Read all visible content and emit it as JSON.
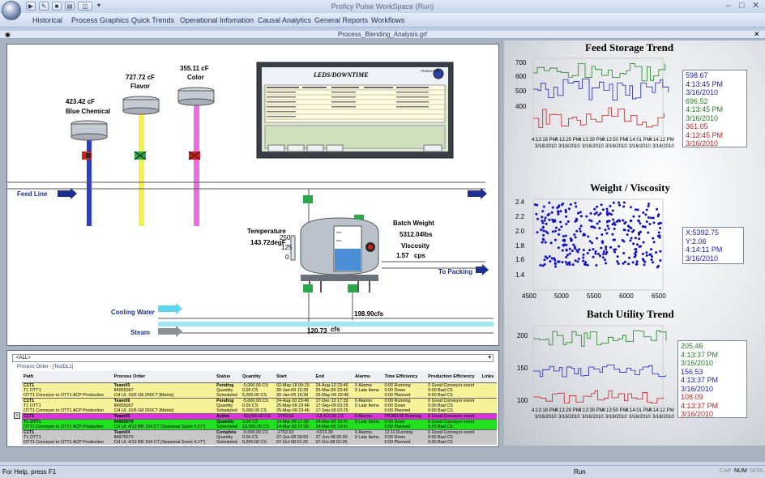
{
  "window": {
    "title": "Proficy Pulse WorkSpace (Run)",
    "document_title": "Process_Blending_Analysis.grf"
  },
  "menu": [
    "Historical",
    "Process Graphics",
    "Quick Trends",
    "Operational Infomation",
    "Causal Analytics",
    "General Reports",
    "Workflows"
  ],
  "process": {
    "blue_chemical": {
      "value": "423.42 cF",
      "name": "Blue Chemical"
    },
    "flavor": {
      "value": "727.72 cF",
      "name": "Flavor"
    },
    "color": {
      "value": "355.11 cF",
      "name": "Color"
    },
    "feed_line": "Feed Line",
    "temperature_label": "Temperature",
    "temperature_value": "143.72degF",
    "level_ticks": [
      "250",
      "125",
      "0"
    ],
    "batch_weight_label": "Batch Weight",
    "batch_weight_value": "5312.04lbs",
    "viscosity_label": "Viscosity",
    "viscosity_value": "1.57",
    "viscosity_unit": "cps",
    "to_packing": "To Packing",
    "cooling_water": "Cooling Water",
    "steam": "Steam",
    "flow1": "198.90cfs",
    "flow2": "120.73",
    "flow2_unit": "cfs",
    "leds_title": "LEDS/DOWNTIME",
    "leds_logo": "PENNSTATE"
  },
  "feed_storage": {
    "title": "Feed Storage Trend",
    "yticks": [
      "700",
      "600",
      "500",
      "400"
    ],
    "xticks": [
      {
        "t": "4:13:18 PM",
        "d": "3/16/2010"
      },
      {
        "t": "4:13:29 PM",
        "d": "3/16/2010"
      },
      {
        "t": "4:13:39 PM",
        "d": "3/16/2010"
      },
      {
        "t": "4:13:50 PM",
        "d": "3/16/2010"
      },
      {
        "t": "4:14:01 PM",
        "d": "3/16/2010"
      },
      {
        "t": "4:14:12 PM",
        "d": "3/16/2010"
      }
    ],
    "readout": [
      {
        "v": "598.67",
        "t": "4:13:45 PM",
        "d": "3/16/2010",
        "color": "#2020c0"
      },
      {
        "v": "696.52",
        "t": "4:13:45 PM",
        "d": "3/16/2010",
        "color": "#208020"
      },
      {
        "v": "361.05",
        "t": "4:13:45 PM",
        "d": "3/16/2010",
        "color": "#c02020"
      }
    ]
  },
  "weight_viscosity": {
    "title": "Weight / Viscosity",
    "yticks": [
      "2.4",
      "2.2",
      "2.0",
      "1.8",
      "1.6",
      "1.4"
    ],
    "xticks": [
      "4500",
      "5000",
      "5500",
      "6000",
      "6500"
    ],
    "readout": [
      "X:5392.75",
      "Y:2.06",
      "4:14:11 PM",
      "3/16/2010"
    ]
  },
  "batch_utility": {
    "title": "Batch Utility Trend",
    "yticks": [
      "200",
      "150",
      "100"
    ],
    "xticks": [
      {
        "t": "4:13:18 PM",
        "d": "3/16/2010"
      },
      {
        "t": "4:13:29 PM",
        "d": "3/16/2010"
      },
      {
        "t": "4:13:39 PM",
        "d": "3/16/2010"
      },
      {
        "t": "4:13:50 PM",
        "d": "3/16/2010"
      },
      {
        "t": "4:14:01 PM",
        "d": "3/16/2010"
      },
      {
        "t": "4:14:12 PM",
        "d": "3/16/2010"
      }
    ],
    "readout": [
      {
        "v": "205.46",
        "t": "4:13:37 PM",
        "d": "3/16/2010",
        "color": "#208020"
      },
      {
        "v": "156.53",
        "t": "4:13:37 PM",
        "d": "3/16/2010",
        "color": "#2020c0"
      },
      {
        "v": "108.09",
        "t": "4:13:37 PM",
        "d": "3/16/2010",
        "color": "#c02020"
      }
    ]
  },
  "orders": {
    "dropdown": "<ALL>",
    "caption": "Process Order - [TestDL1]",
    "headers": [
      "Path",
      "Process Order",
      "Status",
      "Quantity",
      "Start",
      "End",
      "Alarms",
      "Time Efficiency",
      "Production Efficiency",
      "Links"
    ],
    "rows": [
      {
        "bg": "#f6f29a",
        "lines": [
          [
            "C1T1",
            "Team05",
            "Pending",
            "-5,000.00 CS",
            "02-May-18 00:15",
            "24-Aug-10 23:46",
            "0 Alarms",
            "0:00 Running",
            "0 Good Conveyor event"
          ],
          [
            "T1 OTT1",
            "84955067",
            "Quantity",
            "0.00 CS",
            "30-Jan-09 15:39",
            "25-Mar-09 23:46",
            "0 Late Items",
            "0:00 Down",
            "0:00 Bad CS"
          ],
          [
            "OTT1 Conveyor to OTT1 ACP Production",
            "CH UL 16/6 G8 250CT [Matrix]",
            "Scheduled",
            "5,000.00 CS",
            "30-Jan-09 15:39",
            "25-May-09 23:46",
            "",
            "0:00 Planned",
            "0:00 Bad CS"
          ]
        ]
      },
      {
        "bg": "#f6f29a",
        "lines": [
          [
            "C1T1",
            "Team06",
            "Pending",
            "-5,000.00 CS",
            "24-Aug-10 23:46",
            "17-Dec-10 17:39",
            "0 Alarms",
            "0:00 Running",
            "0 Good Conveyor event"
          ],
          [
            "T1 OTT1",
            "84955067",
            "Quantity",
            "0.00 CS",
            "25-May-09 23:46",
            "17-Sep-09 03:25",
            "0 Late Items",
            "0:00 Down",
            "0:00 Bad CS"
          ],
          [
            "OTT1 Conveyor to OTT1 ACP Production",
            "CH UL 16/6 G8 250CT [Matrix]",
            "Scheduled",
            "5,000.00 CS",
            "25-May-09 23:46",
            "17-Sep-09 03:25",
            "",
            "0:00 Planned",
            "0:00 Bad CS"
          ]
        ]
      },
      {
        "bg": "#e030e0",
        "lines": [
          [
            "C1T1",
            "Team05",
            "Active",
            "-50,000.00 CS",
            "-2743.53",
            "-12,410.00 CS",
            "0 Alarms",
            "PR280.00 Running",
            "0 Good Conveyor event"
          ]
        ]
      },
      {
        "bg": "#20e020",
        "lines": [
          [
            "T1 OTT1",
            "84955070",
            "Quantity",
            "0.00 CS",
            "14-Mar-09 17:30",
            "14-Mar-09 19:41",
            "0 Late Items",
            "0:00 Down",
            "0 Good Conveyor event"
          ],
          [
            "OTT1 Conveyor to OTT1 ACP Production",
            "CH UL 4/12 BR 154 CT (Seasonal Scent 4.27\")",
            "Scheduled",
            "10,000.00 CS",
            "14-Mar-09 17:30",
            "14-Mar-09 19:41",
            "",
            "0:00 Planned",
            "0:00 Bad CS"
          ]
        ]
      },
      {
        "bg": "#c8c8c8",
        "lines": [
          [
            "C1T1",
            "Team04",
            "Complete",
            "-5,000.00 CS",
            "-2753.53",
            "-5223.39",
            "0 Alarms",
            "12:11 Running",
            "0 Good Conveyor event"
          ],
          [
            "T1 OTT1",
            "84976070",
            "Quantity",
            "0.00 CS",
            "27-Jun-08 00:00",
            "27-Jun-08 00:00",
            "0 Late Items",
            "0:00 Down",
            "0:00 Bad CS"
          ],
          [
            "OTT1 Conveyor to OTT1 ACP Production",
            "CH UL 4/12 BR 154 CT (Seasonal Scent 4.27\")",
            "Scheduled",
            "5,000.00 CS",
            "07-Oct-08 01:25",
            "07-Oct-08 01:25",
            "",
            "0:00 Planned",
            "0:00 Bad CS"
          ]
        ]
      }
    ]
  },
  "statusbar": {
    "help": "For Help, press F1",
    "mode": "Run",
    "indicators": [
      "CAP",
      "NUM",
      "SCRL"
    ]
  }
}
